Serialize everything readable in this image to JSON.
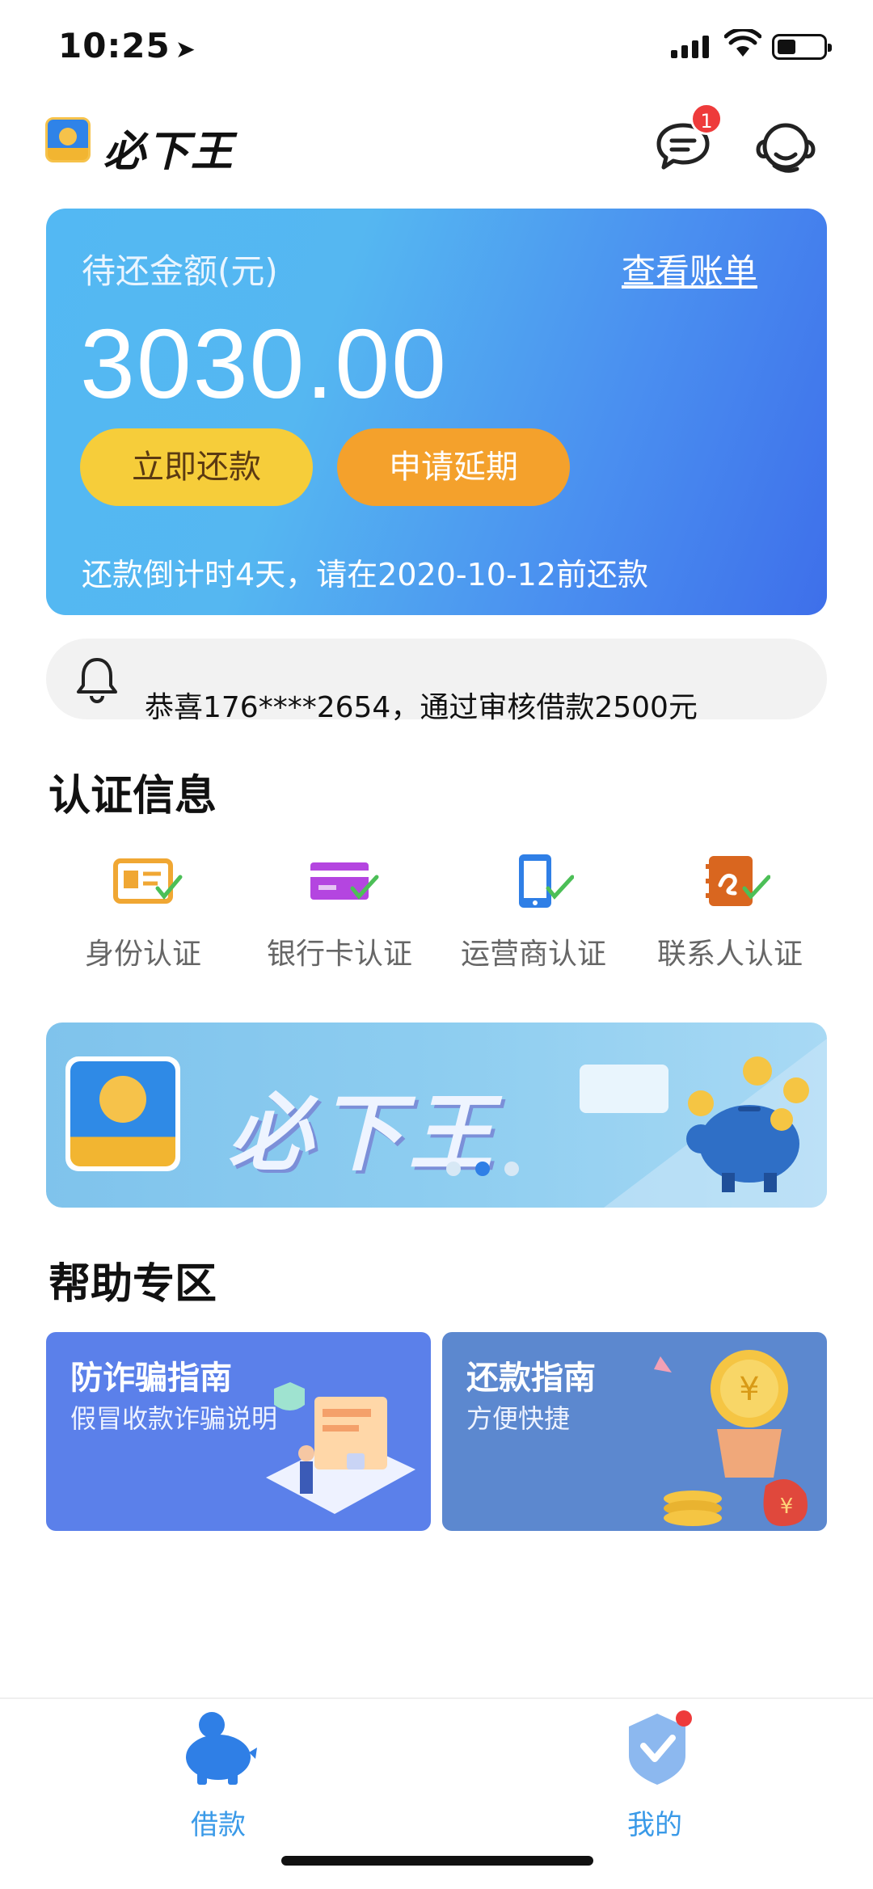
{
  "status_bar": {
    "time": "10:25"
  },
  "header": {
    "brand": "必下王",
    "message_badge": "1"
  },
  "bill": {
    "label": "待还金额(元)",
    "view_bill": "查看账单",
    "amount": "3030.00",
    "repay_now": "立即还款",
    "apply_extension": "申请延期",
    "countdown": "还款倒计时4天，请在2020-10-12前还款"
  },
  "notice": {
    "text": "恭喜176****2654，通过审核借款2500元"
  },
  "auth": {
    "title": "认证信息",
    "items": [
      {
        "label": "身份认证",
        "icon": "id-card-icon",
        "color": "#f0a733"
      },
      {
        "label": "银行卡认证",
        "icon": "bank-card-icon",
        "color": "#b445e0"
      },
      {
        "label": "运营商认证",
        "icon": "phone-icon",
        "color": "#2f7fe6"
      },
      {
        "label": "联系人认证",
        "icon": "contacts-icon",
        "color": "#d9661f"
      }
    ]
  },
  "banner": {
    "title": "必下王",
    "logo_text": "必下王",
    "page_count": 3,
    "active_page": 2
  },
  "help": {
    "title": "帮助专区",
    "cards": [
      {
        "title": "防诈骗指南",
        "subtitle": "假冒收款诈骗说明"
      },
      {
        "title": "还款指南",
        "subtitle": "方便快捷"
      }
    ]
  },
  "tabbar": {
    "items": [
      {
        "label": "借款",
        "icon": "piggy-bank-icon",
        "active": true
      },
      {
        "label": "我的",
        "icon": "profile-badge-icon",
        "active": false
      }
    ],
    "accent": "#3a9ae8"
  }
}
